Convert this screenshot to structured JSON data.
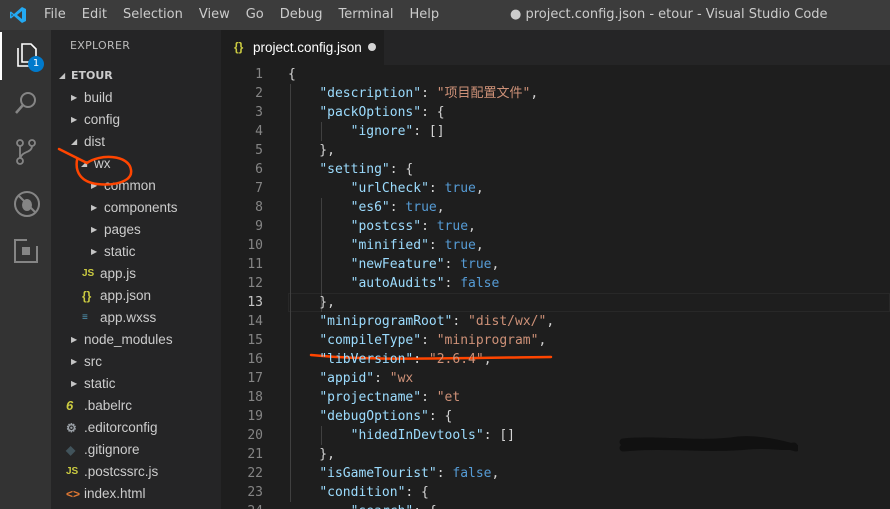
{
  "app": {
    "menu": [
      "File",
      "Edit",
      "Selection",
      "View",
      "Go",
      "Debug",
      "Terminal",
      "Help"
    ],
    "window_title": "● project.config.json - etour - Visual Studio Code"
  },
  "activity_bar": {
    "explorer_badge": "1"
  },
  "sidebar": {
    "header": "EXPLORER",
    "section": "ETOUR",
    "tree": [
      {
        "label": "build",
        "type": "folder",
        "expanded": false,
        "depth": 1
      },
      {
        "label": "config",
        "type": "folder",
        "expanded": false,
        "depth": 1
      },
      {
        "label": "dist",
        "type": "folder",
        "expanded": true,
        "depth": 1
      },
      {
        "label": "wx",
        "type": "folder",
        "expanded": true,
        "depth": 2
      },
      {
        "label": "common",
        "type": "folder",
        "expanded": false,
        "depth": 3
      },
      {
        "label": "components",
        "type": "folder",
        "expanded": false,
        "depth": 3
      },
      {
        "label": "pages",
        "type": "folder",
        "expanded": false,
        "depth": 3
      },
      {
        "label": "static",
        "type": "folder",
        "expanded": false,
        "depth": 3
      },
      {
        "label": "app.js",
        "type": "js",
        "depth": 3
      },
      {
        "label": "app.json",
        "type": "json",
        "depth": 3
      },
      {
        "label": "app.wxss",
        "type": "css",
        "depth": 3
      },
      {
        "label": "node_modules",
        "type": "folder",
        "expanded": false,
        "depth": 1
      },
      {
        "label": "src",
        "type": "folder",
        "expanded": false,
        "depth": 1
      },
      {
        "label": "static",
        "type": "folder",
        "expanded": false,
        "depth": 1
      },
      {
        "label": ".babelrc",
        "type": "babel",
        "depth": 1
      },
      {
        "label": ".editorconfig",
        "type": "gear",
        "depth": 1
      },
      {
        "label": ".gitignore",
        "type": "git",
        "depth": 1
      },
      {
        "label": ".postcssrc.js",
        "type": "js",
        "depth": 1
      },
      {
        "label": "index.html",
        "type": "html",
        "depth": 1
      }
    ]
  },
  "editor": {
    "tab_label": "project.config.json",
    "tab_icon": "{}",
    "current_line": 13,
    "lines": [
      [
        [
          "p",
          "{"
        ]
      ],
      [
        [
          "p",
          "    "
        ],
        [
          "k",
          "\"description\""
        ],
        [
          "p",
          ": "
        ],
        [
          "s",
          "\"项目配置文件\""
        ],
        [
          "p",
          ","
        ]
      ],
      [
        [
          "p",
          "    "
        ],
        [
          "k",
          "\"packOptions\""
        ],
        [
          "p",
          ": {"
        ]
      ],
      [
        [
          "p",
          "        "
        ],
        [
          "k",
          "\"ignore\""
        ],
        [
          "p",
          ": []"
        ]
      ],
      [
        [
          "p",
          "    },"
        ]
      ],
      [
        [
          "p",
          "    "
        ],
        [
          "k",
          "\"setting\""
        ],
        [
          "p",
          ": {"
        ]
      ],
      [
        [
          "p",
          "        "
        ],
        [
          "k",
          "\"urlCheck\""
        ],
        [
          "p",
          ": "
        ],
        [
          "b",
          "true"
        ],
        [
          "p",
          ","
        ]
      ],
      [
        [
          "p",
          "        "
        ],
        [
          "k",
          "\"es6\""
        ],
        [
          "p",
          ": "
        ],
        [
          "b",
          "true"
        ],
        [
          "p",
          ","
        ]
      ],
      [
        [
          "p",
          "        "
        ],
        [
          "k",
          "\"postcss\""
        ],
        [
          "p",
          ": "
        ],
        [
          "b",
          "true"
        ],
        [
          "p",
          ","
        ]
      ],
      [
        [
          "p",
          "        "
        ],
        [
          "k",
          "\"minified\""
        ],
        [
          "p",
          ": "
        ],
        [
          "b",
          "true"
        ],
        [
          "p",
          ","
        ]
      ],
      [
        [
          "p",
          "        "
        ],
        [
          "k",
          "\"newFeature\""
        ],
        [
          "p",
          ": "
        ],
        [
          "b",
          "true"
        ],
        [
          "p",
          ","
        ]
      ],
      [
        [
          "p",
          "        "
        ],
        [
          "k",
          "\"autoAudits\""
        ],
        [
          "p",
          ": "
        ],
        [
          "b",
          "false"
        ]
      ],
      [
        [
          "p",
          "    },"
        ]
      ],
      [
        [
          "p",
          "    "
        ],
        [
          "k",
          "\"miniprogramRoot\""
        ],
        [
          "p",
          ": "
        ],
        [
          "s",
          "\"dist/wx/\""
        ],
        [
          "p",
          ","
        ]
      ],
      [
        [
          "p",
          "    "
        ],
        [
          "k",
          "\"compileType\""
        ],
        [
          "p",
          ": "
        ],
        [
          "s",
          "\"miniprogram\""
        ],
        [
          "p",
          ","
        ]
      ],
      [
        [
          "p",
          "    "
        ],
        [
          "k",
          "\"libVersion\""
        ],
        [
          "p",
          ": "
        ],
        [
          "s",
          "\"2.6.4\""
        ],
        [
          "p",
          ","
        ]
      ],
      [
        [
          "p",
          "    "
        ],
        [
          "k",
          "\"appid\""
        ],
        [
          "p",
          ": "
        ],
        [
          "s",
          "\"wx"
        ],
        [
          "p",
          ""
        ]
      ],
      [
        [
          "p",
          "    "
        ],
        [
          "k",
          "\"projectname\""
        ],
        [
          "p",
          ": "
        ],
        [
          "s",
          "\"et"
        ],
        [
          "p",
          ""
        ]
      ],
      [
        [
          "p",
          "    "
        ],
        [
          "k",
          "\"debugOptions\""
        ],
        [
          "p",
          ": {"
        ]
      ],
      [
        [
          "p",
          "        "
        ],
        [
          "k",
          "\"hidedInDevtools\""
        ],
        [
          "p",
          ": []"
        ]
      ],
      [
        [
          "p",
          "    },"
        ]
      ],
      [
        [
          "p",
          "    "
        ],
        [
          "k",
          "\"isGameTourist\""
        ],
        [
          "p",
          ": "
        ],
        [
          "b",
          "false"
        ],
        [
          "p",
          ","
        ]
      ],
      [
        [
          "p",
          "    "
        ],
        [
          "k",
          "\"condition\""
        ],
        [
          "p",
          ": {"
        ]
      ],
      [
        [
          "p",
          "        "
        ],
        [
          "k",
          "\"search\""
        ],
        [
          "p",
          ": {"
        ]
      ]
    ]
  }
}
